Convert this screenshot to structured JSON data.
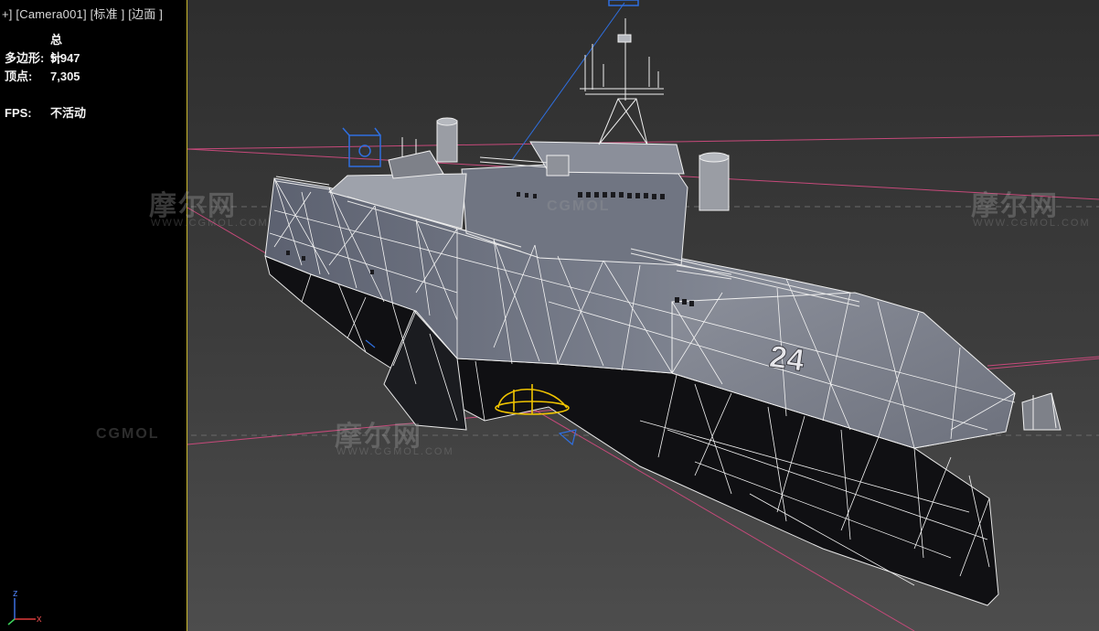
{
  "viewport": {
    "label": "+] [Camera001] [标准 ] [边面 ]"
  },
  "stats": {
    "header": "总计",
    "polygons_label": "多边形:",
    "polygons_value": "5,947",
    "vertices_label": "顶点:",
    "vertices_value": "7,305",
    "fps_label": "FPS:",
    "fps_value": "不活动"
  },
  "hull": {
    "number": "24"
  },
  "watermarks": {
    "brand": "摩尔网",
    "domain": "WWW.CGMOL.COM",
    "cg": "CGMOL"
  },
  "axis": {
    "z": "z",
    "x": "x"
  },
  "colors": {
    "frame_border": "#c9b72e",
    "grid_line": "#c6497a",
    "camera_helper": "#2f6fe0",
    "selection": "#f0c400"
  },
  "icons": {
    "camera_target": "camera-target-icon",
    "light_helper": "light-helper-icon"
  }
}
